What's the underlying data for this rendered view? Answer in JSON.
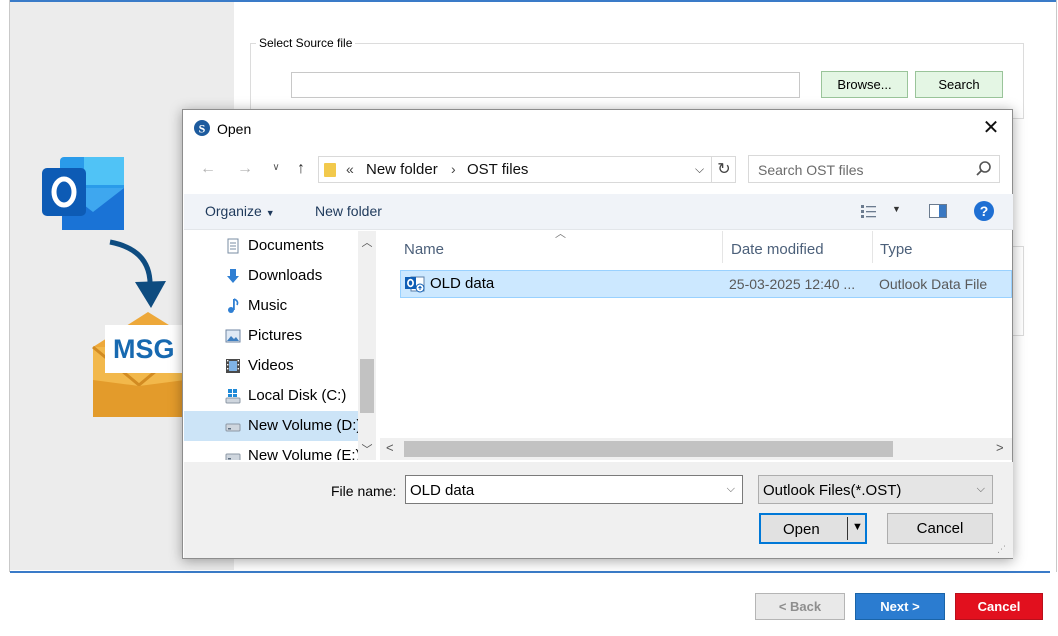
{
  "wizard": {
    "group_label": "Select Source file",
    "browse_label": "Browse...",
    "search_label": "Search",
    "back_label": "< Back",
    "next_label": "Next >",
    "cancel_label": "Cancel",
    "illustration_text": "MSG",
    "colors": {
      "accent": "#3a7bc8",
      "next": "#2b7cd0",
      "cancel": "#e2101e",
      "button_green": "#e4f6e4"
    }
  },
  "dialog": {
    "title": "Open",
    "breadcrumb_prefix": "«",
    "breadcrumb": [
      "New folder",
      "OST files"
    ],
    "search_placeholder": "Search OST files",
    "toolbar": {
      "organize": "Organize",
      "new_folder": "New folder"
    },
    "nav_tree": [
      {
        "label": "Documents",
        "icon": "documents-icon"
      },
      {
        "label": "Downloads",
        "icon": "downloads-icon"
      },
      {
        "label": "Music",
        "icon": "music-icon"
      },
      {
        "label": "Pictures",
        "icon": "pictures-icon"
      },
      {
        "label": "Videos",
        "icon": "videos-icon"
      },
      {
        "label": "Local Disk (C:)",
        "icon": "local-disk-icon"
      },
      {
        "label": "New Volume (D:)",
        "icon": "drive-icon",
        "selected": true
      },
      {
        "label": "New Volume (E:)",
        "icon": "drive-icon"
      }
    ],
    "columns": [
      "Name",
      "Date modified",
      "Type"
    ],
    "files": [
      {
        "name": "OLD data",
        "date_modified": "25-03-2025 12:40 ...",
        "type": "Outlook Data File",
        "selected": true
      }
    ],
    "file_name_label": "File name:",
    "file_name_value": "OLD data",
    "file_type_value": "Outlook Files(*.OST)",
    "open_label": "Open",
    "cancel_label": "Cancel",
    "colors": {
      "selection": "#cce8ff",
      "help": "#1f6fd3"
    }
  }
}
